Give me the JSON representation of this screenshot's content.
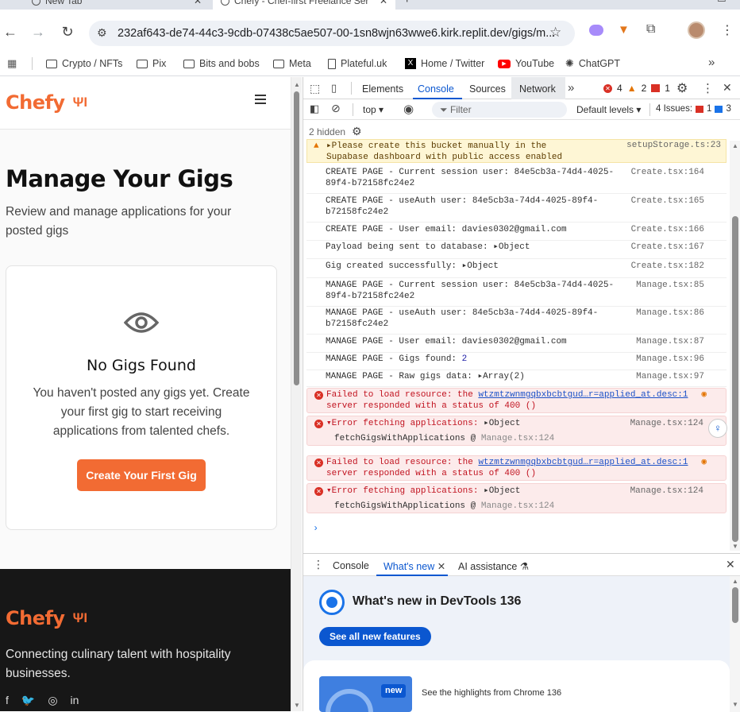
{
  "browser": {
    "tabs": [
      {
        "label": "New Tab"
      },
      {
        "label": "Chefy - Chef-first Freelance Ser"
      }
    ],
    "url": "232af643-de74-44c3-9cdb-07438c5ae507-00-1sn8wjn63wwe6.kirk.replit.dev/gigs/m...",
    "bookmarks": [
      "Crypto / NFTs",
      "Pix",
      "Bits and bobs",
      "Meta",
      "Plateful.uk",
      "Home / Twitter",
      "YouTube",
      "ChatGPT"
    ]
  },
  "site": {
    "logo": "Chefy",
    "title": "Manage Your Gigs",
    "subtitle": "Review and manage applications for your posted gigs",
    "empty_title": "No Gigs Found",
    "empty_text": "You haven't posted any gigs yet. Create your first gig to start receiving applications from talented chefs.",
    "cta": "Create Your First Gig",
    "footer_logo": "Chefy",
    "footer_text": "Connecting culinary talent with hospitality businesses.",
    "colors": {
      "brand": "#f26b33",
      "footer_bg": "#171717"
    }
  },
  "devtools": {
    "tabs": [
      "Elements",
      "Console",
      "Sources",
      "Network"
    ],
    "errors_count": "4",
    "warnings_count": "2",
    "issues_badge": "1",
    "context": "top",
    "filter_placeholder": "Filter",
    "levels": "Default levels",
    "issues_label": "4 Issues:",
    "issues_err": "1",
    "issues_info": "3",
    "hidden": "2 hidden",
    "logs": [
      {
        "type": "warn",
        "text": "Please create this bucket manually in the Supabase dashboard with public access enabled",
        "src": "setupStorage.ts:23"
      },
      {
        "type": "log",
        "text": "CREATE PAGE - Current session user: 84e5cb3a-74d4-4025-89f4-b72158fc24e2",
        "src": "Create.tsx:164"
      },
      {
        "type": "log",
        "text": "CREATE PAGE - useAuth user: 84e5cb3a-74d4-4025-89f4-b72158fc24e2",
        "src": "Create.tsx:165"
      },
      {
        "type": "log",
        "text": "CREATE PAGE - User email: davies0302@gmail.com",
        "src": "Create.tsx:166"
      },
      {
        "type": "log",
        "text": "Payload being sent to database:",
        "obj": "Object",
        "src": "Create.tsx:167"
      },
      {
        "type": "log",
        "text": "Gig created successfully:",
        "obj": "Object",
        "src": "Create.tsx:182"
      },
      {
        "type": "log",
        "text": "MANAGE PAGE - Current session user: 84e5cb3a-74d4-4025-89f4-b72158fc24e2",
        "src": "Manage.tsx:85"
      },
      {
        "type": "log",
        "text": "MANAGE PAGE - useAuth user: 84e5cb3a-74d4-4025-89f4-b72158fc24e2",
        "src": "Manage.tsx:86"
      },
      {
        "type": "log",
        "text": "MANAGE PAGE - User email: davies0302@gmail.com",
        "src": "Manage.tsx:87"
      },
      {
        "type": "log",
        "text": "MANAGE PAGE - Gigs found:",
        "num": "2",
        "src": "Manage.tsx:96"
      },
      {
        "type": "log",
        "text": "MANAGE PAGE - Raw gigs data:",
        "obj": "Array(2)",
        "src": "Manage.tsx:97"
      }
    ],
    "errors": [
      {
        "pre": "Failed to load resource: the ",
        "link": "wtzmtzwnmgqbxbcbtgud…r=applied_at.desc:1",
        "post": "server responded with a status of 400 ()"
      },
      {
        "pre": "Error fetching applications:",
        "obj": "Object",
        "src": "Manage.tsx:124",
        "stack": "fetchGigsWithApplications @",
        "stack_src": "Manage.tsx:124"
      },
      {
        "pre": "Failed to load resource: the ",
        "link": "wtzmtzwnmgqbxbcbtgud…r=applied_at.desc:1",
        "post": "server responded with a status of 400 ()"
      },
      {
        "pre": "Error fetching applications:",
        "obj": "Object",
        "src": "Manage.tsx:124",
        "stack": "fetchGigsWithApplications @",
        "stack_src": "Manage.tsx:124"
      }
    ],
    "drawer_tabs": [
      "Console",
      "What's new",
      "AI assistance"
    ],
    "whats_new_title": "What's new in DevTools 136",
    "see_all": "See all new features",
    "new_badge": "new",
    "highlight": "See the highlights from Chrome 136"
  }
}
